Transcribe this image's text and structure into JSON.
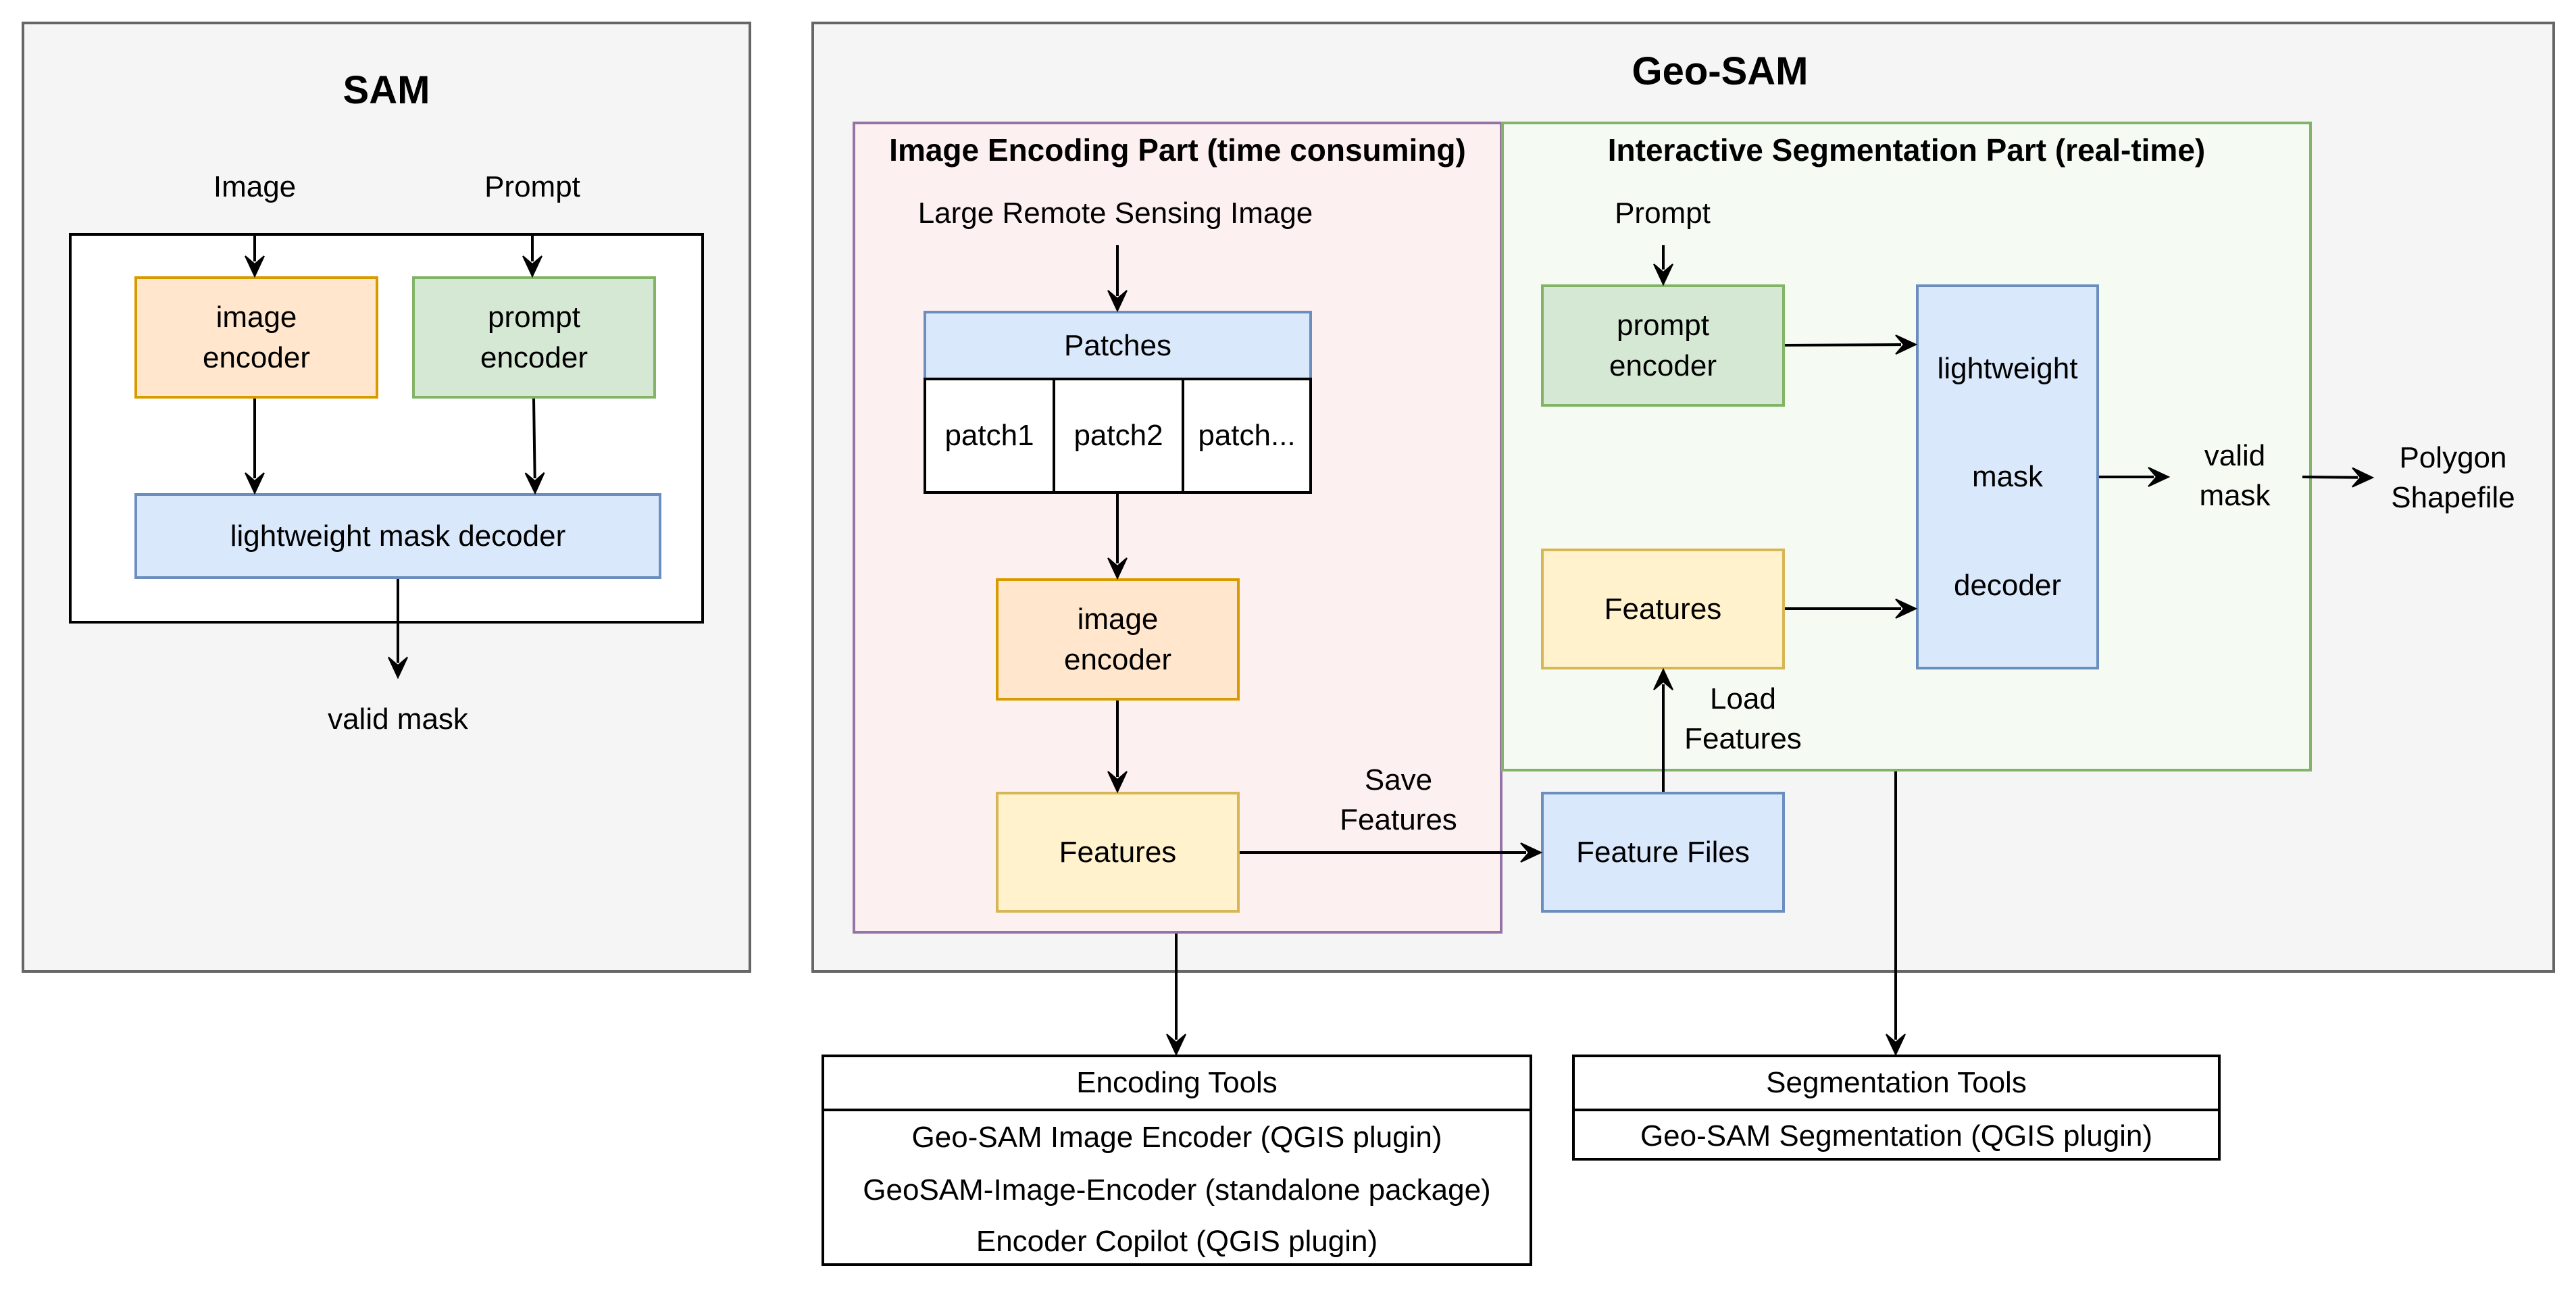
{
  "sam": {
    "title": "SAM",
    "input_image": "Image",
    "input_prompt": "Prompt",
    "image_encoder": "image\nencoder",
    "prompt_encoder": "prompt\nencoder",
    "mask_decoder": "lightweight mask decoder",
    "output": "valid mask"
  },
  "geosam": {
    "title": "Geo-SAM",
    "encoding_part": {
      "title": "Image Encoding Part (time consuming)",
      "input": "Large Remote Sensing Image",
      "patches_header": "Patches",
      "patches": [
        "patch1",
        "patch2",
        "patch..."
      ],
      "image_encoder": "image\nencoder",
      "features": "Features",
      "save_label": "Save\nFeatures"
    },
    "feature_files": "Feature Files",
    "load_label": "Load\nFeatures",
    "segmentation_part": {
      "title": "Interactive Segmentation Part (real-time)",
      "input_prompt": "Prompt",
      "prompt_encoder": "prompt\nencoder",
      "features": "Features",
      "decoder_lines": [
        "lightweight",
        "mask",
        "decoder"
      ],
      "output": "valid\nmask"
    },
    "final_output": "Polygon\nShapefile"
  },
  "tools": {
    "encoding": {
      "header": "Encoding Tools",
      "items": [
        "Geo-SAM Image Encoder (QGIS plugin)",
        "GeoSAM-Image-Encoder (standalone package)",
        "Encoder Copilot (QGIS plugin)"
      ]
    },
    "segmentation": {
      "header": "Segmentation Tools",
      "items": [
        "Geo-SAM Segmentation (QGIS plugin)"
      ]
    }
  }
}
